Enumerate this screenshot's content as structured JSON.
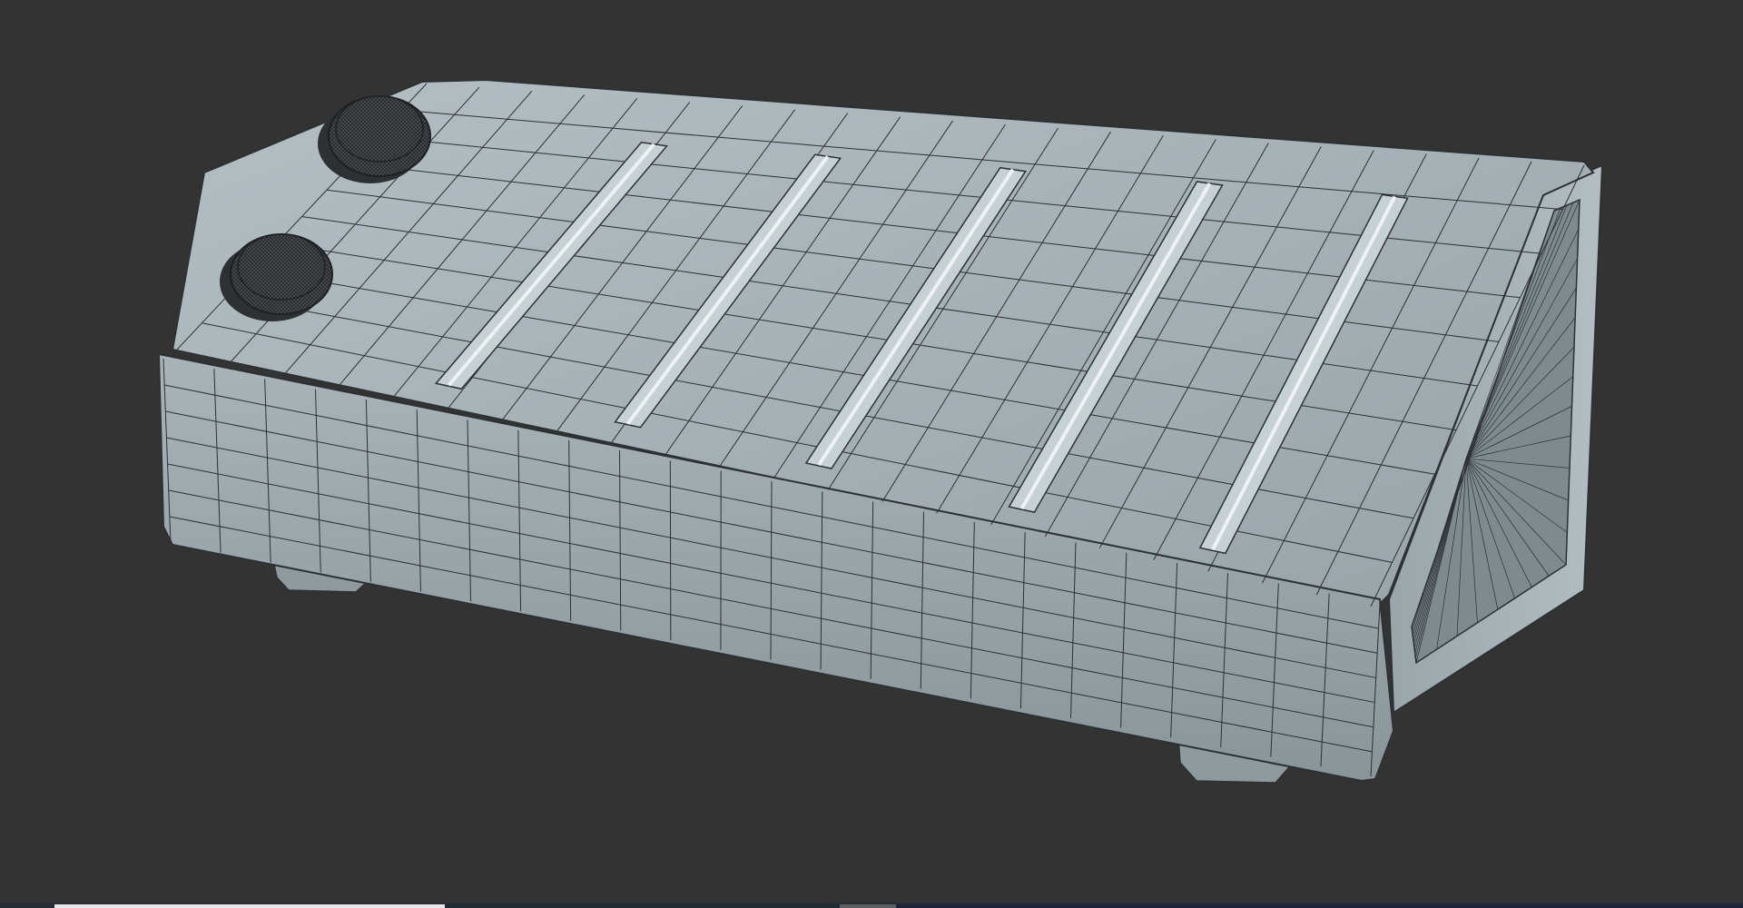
{
  "viewport": {
    "background": "#333333",
    "mesh_color": "#a2acb1",
    "wire_color": "#2c3134",
    "knob_color": "#4a4d50"
  },
  "model": {
    "object": "wireframe-box-model",
    "knobs": [
      "knob-1",
      "knob-2"
    ],
    "ribs": 5,
    "feet": 2
  },
  "bottom_bar": {
    "segments": [
      "timeline-light",
      "timeline-track",
      "timeline-handle",
      "timeline-rest"
    ]
  }
}
